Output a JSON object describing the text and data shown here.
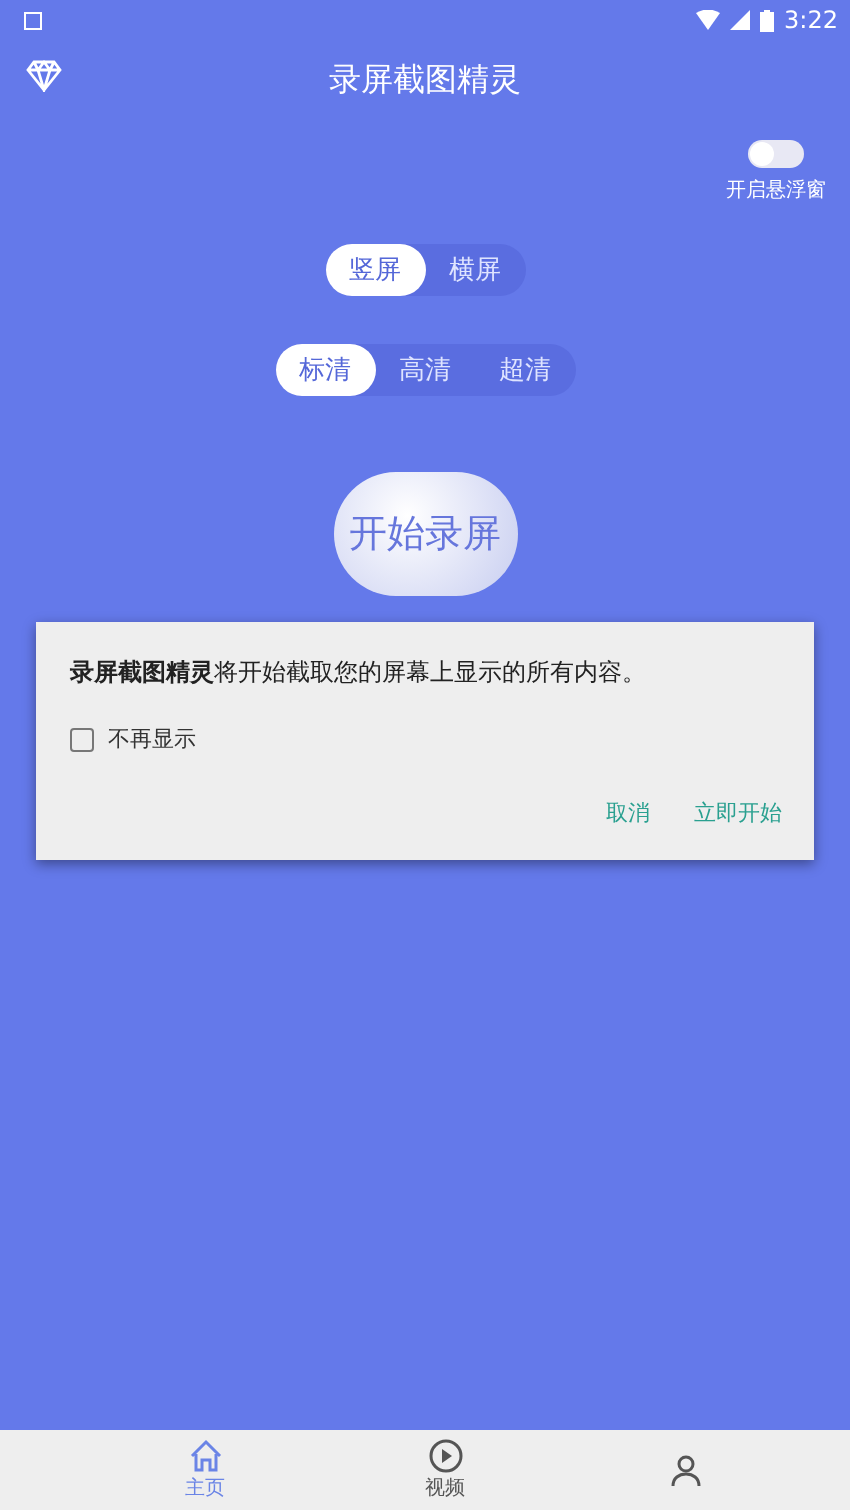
{
  "status_bar": {
    "time": "3:22"
  },
  "header": {
    "title": "录屏截图精灵"
  },
  "float_toggle": {
    "label": "开启悬浮窗",
    "on": false
  },
  "orientation_tabs": [
    {
      "label": "竖屏",
      "selected": true
    },
    {
      "label": "横屏",
      "selected": false
    }
  ],
  "quality_tabs": [
    {
      "label": "标清",
      "selected": true
    },
    {
      "label": "高清",
      "selected": false
    },
    {
      "label": "超清",
      "selected": false
    }
  ],
  "start_button": {
    "label": "开始录屏"
  },
  "dialog": {
    "message": "**录屏截图精灵**将开始截取您的屏幕上显示的所有内容。",
    "checkbox": {
      "label": "不再显示",
      "checked": false
    },
    "buttons": [
      "取消",
      "立即开始"
    ]
  },
  "bottom_nav": [
    {
      "kind": "home",
      "label": "主页",
      "selected": true
    },
    {
      "kind": "video",
      "label": "视频",
      "selected": false
    },
    {
      "kind": "user",
      "selected": false
    }
  ]
}
